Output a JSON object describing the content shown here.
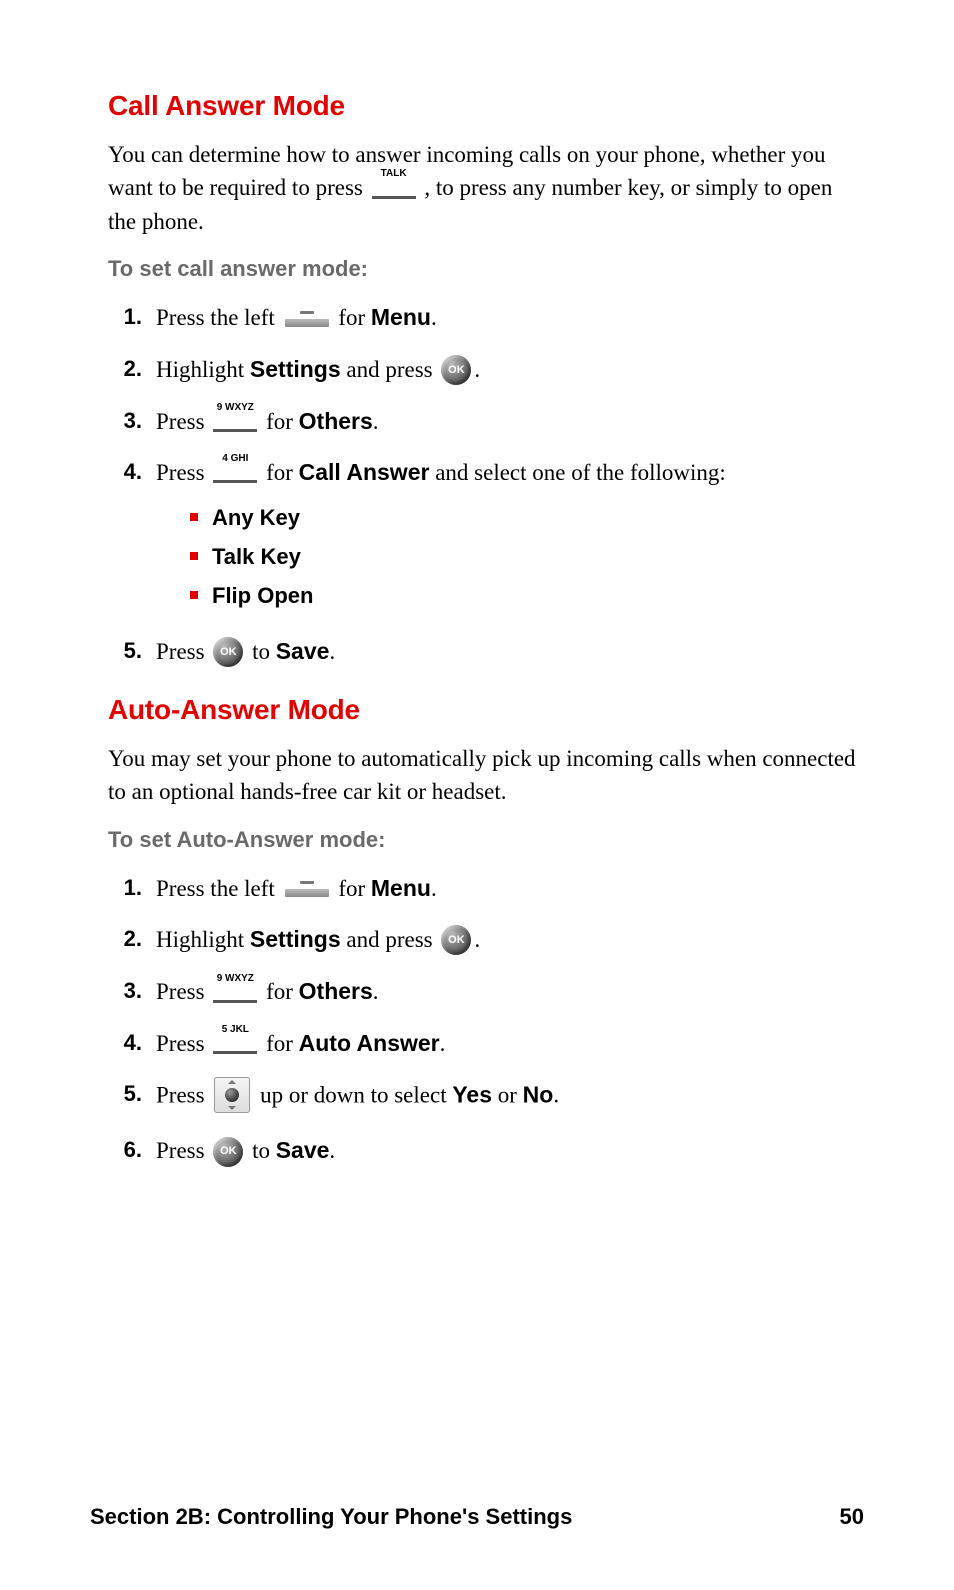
{
  "section1": {
    "title": "Call Answer Mode",
    "intro_a": "You can determine how to answer incoming calls on your phone, whether you want to be required to press ",
    "intro_b": ", to press any number key, or simply to open the phone.",
    "talk_key_label": "TALK",
    "subhead": "To set call answer mode:",
    "steps": {
      "s1_a": "Press the left ",
      "s1_b": " for ",
      "s1_bold": "Menu",
      "s1_c": ".",
      "s2_a": "Highlight ",
      "s2_bold": "Settings",
      "s2_b": " and press ",
      "s2_c": ".",
      "s3_a": "Press ",
      "s3_key": "9 WXYZ",
      "s3_b": " for ",
      "s3_bold": "Others",
      "s3_c": ".",
      "s4_a": "Press ",
      "s4_key": "4 GHI",
      "s4_b": " for ",
      "s4_bold": "Call Answer",
      "s4_c": " and select one of the following:",
      "bullets": [
        "Any Key",
        "Talk Key",
        "Flip Open"
      ],
      "s5_a": "Press ",
      "s5_b": " to ",
      "s5_bold": "Save",
      "s5_c": "."
    }
  },
  "section2": {
    "title": "Auto-Answer Mode",
    "intro": "You may set your phone to automatically pick up incoming calls when connected to an optional hands-free car kit or headset.",
    "subhead": "To set Auto-Answer mode:",
    "steps": {
      "s1_a": "Press the left ",
      "s1_b": " for ",
      "s1_bold": "Menu",
      "s1_c": ".",
      "s2_a": "Highlight ",
      "s2_bold": "Settings",
      "s2_b": " and press ",
      "s2_c": ".",
      "s3_a": "Press ",
      "s3_key": "9 WXYZ",
      "s3_b": " for ",
      "s3_bold": "Others",
      "s3_c": ".",
      "s4_a": "Press ",
      "s4_key": "5 JKL",
      "s4_b": " for ",
      "s4_bold": "Auto Answer",
      "s4_c": ".",
      "s5_a": "Press ",
      "s5_b": " up or down to select ",
      "s5_bold1": "Yes",
      "s5_mid": " or ",
      "s5_bold2": "No",
      "s5_c": ".",
      "s6_a": "Press ",
      "s6_b": " to ",
      "s6_bold": "Save",
      "s6_c": "."
    }
  },
  "ok_label": "OK",
  "footer": {
    "left": "Section 2B: Controlling Your Phone's Settings",
    "right": "50"
  }
}
